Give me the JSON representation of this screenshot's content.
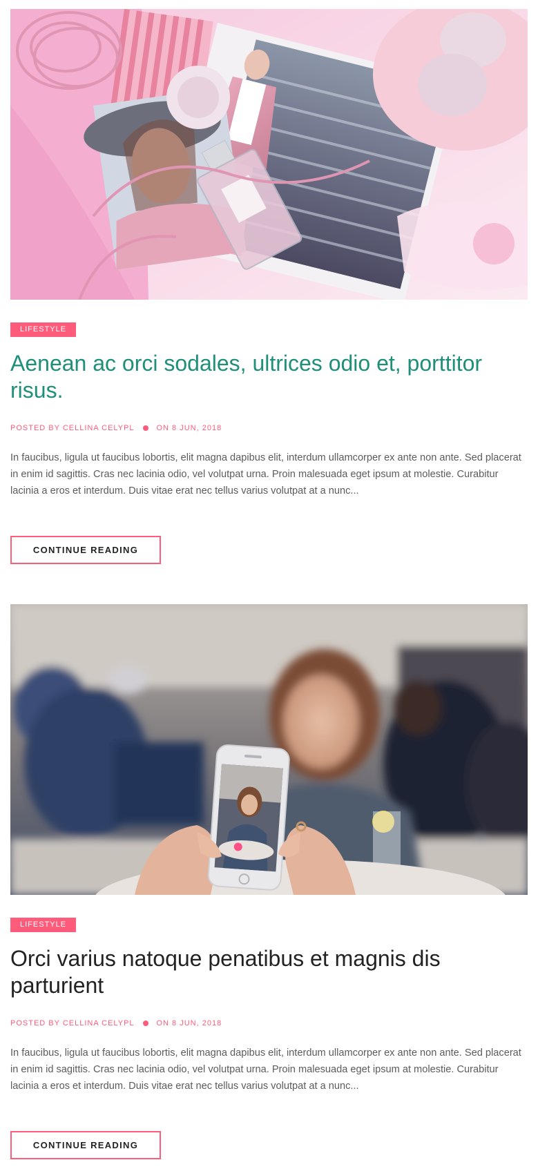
{
  "posts": [
    {
      "category": "LIFESTYLE",
      "title": "Aenean ac orci sodales, ultrices odio et, porttitor risus.",
      "meta": {
        "author": "POSTED BY CELLINA CELYPL",
        "date": "ON 8 JUN, 2018"
      },
      "excerpt": "In faucibus, ligula ut faucibus lobortis, elit magna dapibus elit, interdum ullamcorper ex ante non ante. Sed placerat in enim id sagittis. Cras nec lacinia odio, vel volutpat urna. Proin malesuada eget ipsum at molestie. Curabitur lacinia a eros et interdum. Duis vitae erat nec tellus varius volutpat at a nunc...",
      "button": "CONTINUE READING",
      "image_alt": "Pink fashion flat lay with magazine, perfume bottle and meringues"
    },
    {
      "category": "LIFESTYLE",
      "title": "Orci varius natoque penatibus et magnis dis parturient",
      "meta": {
        "author": "POSTED BY CELLINA CELYPL",
        "date": "ON 8 JUN, 2018"
      },
      "excerpt": "In faucibus, ligula ut faucibus lobortis, elit magna dapibus elit, interdum ullamcorper ex ante non ante. Sed placerat in enim id sagittis. Cras nec lacinia odio, vel volutpat urna. Proin malesuada eget ipsum at molestie. Curabitur lacinia a eros et interdum. Duis vitae erat nec tellus varius volutpat at a nunc...",
      "button": "CONTINUE READING",
      "image_alt": "Hands holding a smartphone photographing a smiling woman at an outdoor cafe"
    }
  ],
  "colors": {
    "accent": "#ff5b7b",
    "title_highlight": "#1f8f7a",
    "title": "#222222",
    "body_text": "#5b5b5b"
  }
}
